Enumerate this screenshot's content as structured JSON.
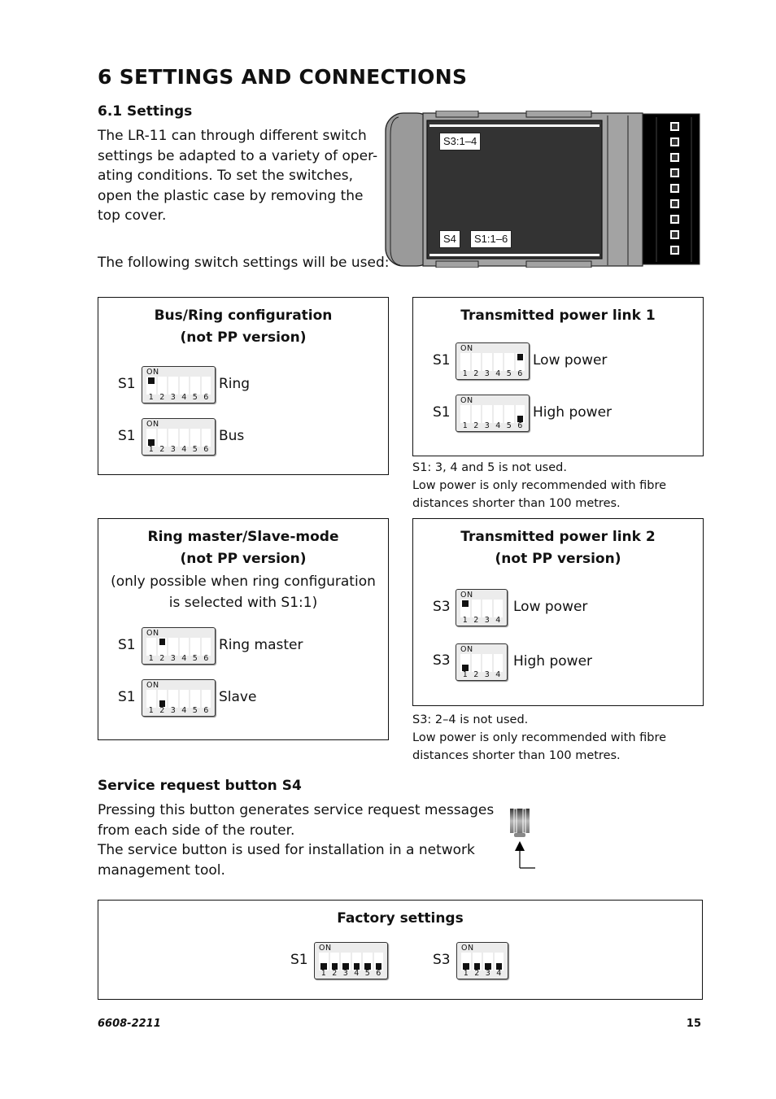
{
  "heading": "6  SETTINGS AND CONNECTIONS",
  "section": {
    "title": "6.1 Settings",
    "intro_lines": [
      "The LR-11 can through different switch",
      "settings be adapted to a variety of oper-",
      "ating conditions. To set the switches,",
      "open the plastic case by removing the",
      "top cover."
    ],
    "following": "The following switch settings will be used:"
  },
  "device": {
    "tags": {
      "s3": "S3:1–4",
      "s4": "S4",
      "s1": "S1:1–6"
    },
    "led_count": 9
  },
  "dip_on_label": "ON",
  "boxes": {
    "bus_ring": {
      "title": "Bus/Ring configuration",
      "subtitle": "(not PP version)",
      "rows": [
        {
          "switch": "S1",
          "label": "Ring",
          "positions": 6,
          "states": [
            "up",
            "off",
            "off",
            "off",
            "off",
            "off"
          ]
        },
        {
          "switch": "S1",
          "label": "Bus",
          "positions": 6,
          "states": [
            "down",
            "off",
            "off",
            "off",
            "off",
            "off"
          ]
        }
      ]
    },
    "power_link1": {
      "title": "Transmitted power link 1",
      "rows": [
        {
          "switch": "S1",
          "label": "Low power",
          "positions": 6,
          "states": [
            "off",
            "off",
            "off",
            "off",
            "off",
            "up"
          ]
        },
        {
          "switch": "S1",
          "label": "High power",
          "positions": 6,
          "states": [
            "off",
            "off",
            "off",
            "off",
            "off",
            "down"
          ]
        }
      ],
      "notes": [
        "S1: 3, 4 and 5 is not used.",
        "Low power is only recommended with fibre",
        "distances shorter than 100 metres."
      ]
    },
    "ring_master": {
      "title": "Ring master/Slave-mode",
      "subtitle": "(not PP version)",
      "description_lines": [
        "(only possible when ring configuration",
        "is selected with S1:1)"
      ],
      "rows": [
        {
          "switch": "S1",
          "label": "Ring master",
          "positions": 6,
          "states": [
            "off",
            "up",
            "off",
            "off",
            "off",
            "off"
          ]
        },
        {
          "switch": "S1",
          "label": "Slave",
          "positions": 6,
          "states": [
            "off",
            "down",
            "off",
            "off",
            "off",
            "off"
          ]
        }
      ]
    },
    "power_link2": {
      "title": "Transmitted power link 2",
      "subtitle": "(not PP version)",
      "rows": [
        {
          "switch": "S3",
          "label": "Low power",
          "positions": 4,
          "states": [
            "up",
            "off",
            "off",
            "off"
          ]
        },
        {
          "switch": "S3",
          "label": "High power",
          "positions": 4,
          "states": [
            "down",
            "off",
            "off",
            "off"
          ]
        }
      ],
      "notes": [
        "S3: 2–4 is not used.",
        "Low power is only recommended with fibre",
        "distances shorter than 100 metres."
      ]
    },
    "factory": {
      "title": "Factory settings",
      "rows": [
        {
          "switch": "S1",
          "positions": 6,
          "states": [
            "down",
            "down",
            "down",
            "down",
            "down",
            "down"
          ]
        },
        {
          "switch": "S3",
          "positions": 4,
          "states": [
            "down",
            "down",
            "down",
            "down"
          ]
        }
      ]
    }
  },
  "service": {
    "title": "Service request button S4",
    "lines": [
      "Pressing this button generates service request messages",
      "from each side of the router.",
      "The service button is used for installation in a network",
      "management tool."
    ]
  },
  "footer": {
    "doc_number": "6608-2211",
    "page_number": "15"
  }
}
